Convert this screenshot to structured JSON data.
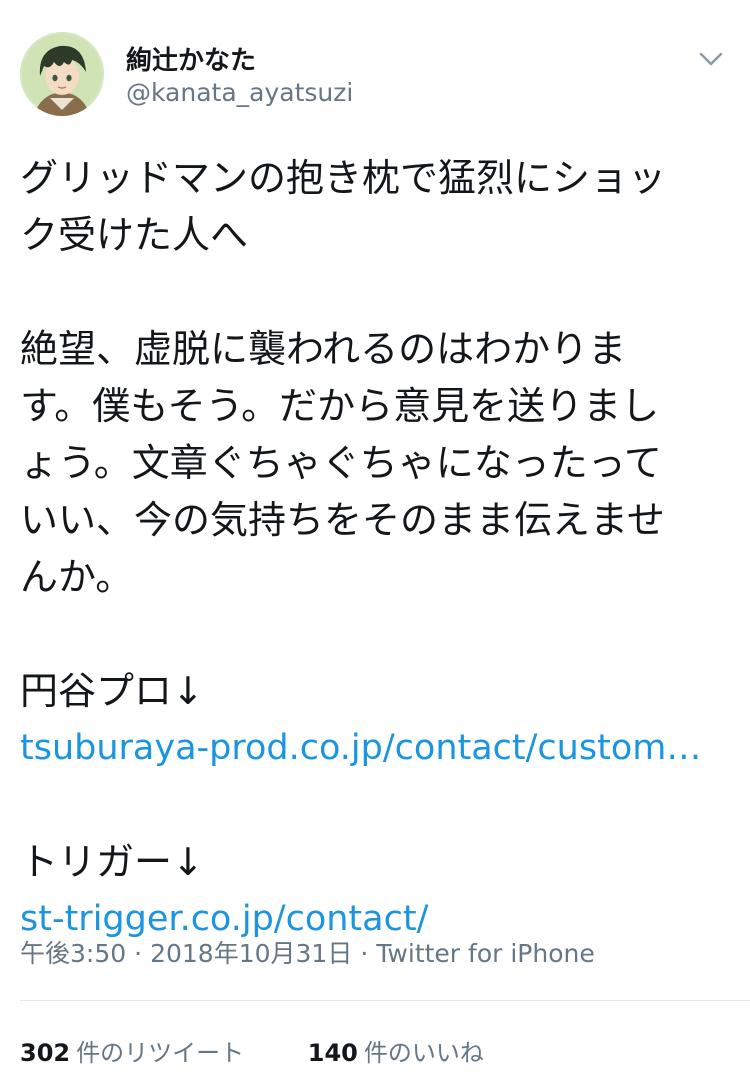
{
  "user": {
    "display_name": "絢辻かなた",
    "handle": "@kanata_ayatsuzi"
  },
  "tweet": {
    "lines": [
      "グリッドマンの抱き枕で猛烈にショッ",
      "ク受けた人へ",
      "",
      "絶望、虚脱に襲われるのはわかりま",
      "す。僕もそう。だから意見を送りまし",
      "ょう。文章ぐちゃぐちゃになったって",
      "いい、今の気持ちをそのまま伝えませ",
      "んか。",
      ""
    ],
    "section1_label": "円谷プロ↓",
    "section1_link": "tsuburaya-prod.co.jp/contact/custom…",
    "section2_label": "トリガー↓",
    "section2_link": "st-trigger.co.jp/contact/"
  },
  "meta": {
    "time": "午後3:50",
    "separator": "·",
    "date": "2018年10月31日",
    "source": "Twitter for iPhone"
  },
  "stats": {
    "retweets_count": "302",
    "retweets_label": "件のリツイート",
    "likes_count": "140",
    "likes_label": "件のいいね"
  },
  "icons": {
    "menu": "chevron-down-icon",
    "avatar": "avatar-illustration"
  },
  "colors": {
    "link": "#1b95e0",
    "secondary_text": "#657786",
    "primary_text": "#14171a",
    "divider": "#e1e8ed"
  }
}
